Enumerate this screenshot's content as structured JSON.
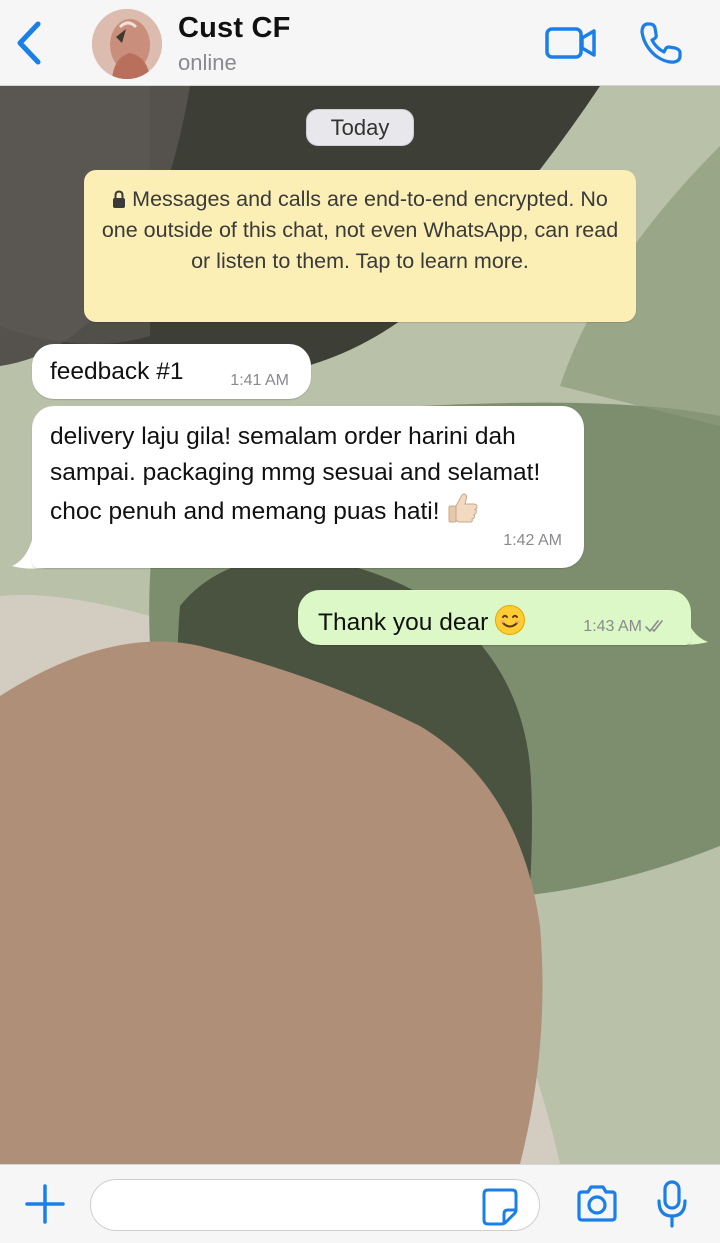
{
  "header": {
    "contact_name": "Cust CF",
    "status": "online",
    "back_icon": "chevron-left-icon",
    "video_icon": "video-camera-icon",
    "call_icon": "phone-icon"
  },
  "chat": {
    "date_label": "Today",
    "encryption_notice": "Messages and calls are end-to-end encrypted. No one outside of this chat, not even WhatsApp, can read or listen to them. Tap to learn more.",
    "messages": [
      {
        "direction": "incoming",
        "text": "feedback #1",
        "time": "1:41 AM"
      },
      {
        "direction": "incoming",
        "text": "delivery laju gila! semalam order harini dah sampai. packaging mmg sesuai and selamat! choc penuh and memang puas hati!",
        "emoji": "thumbs-up-light-skin",
        "time": "1:42 AM"
      },
      {
        "direction": "outgoing",
        "text": "Thank you dear",
        "emoji": "smiling-face",
        "time": "1:43 AM",
        "status": "delivered"
      }
    ]
  },
  "input_bar": {
    "placeholder": "",
    "plus_icon": "plus-icon",
    "sticker_icon": "sticker-icon",
    "camera_icon": "camera-icon",
    "mic_icon": "microphone-icon"
  },
  "colors": {
    "accent": "#1a7fe8",
    "outgoing_bubble": "#dcf8c6",
    "incoming_bubble": "#ffffff",
    "notice_bg": "#fbefb6"
  }
}
